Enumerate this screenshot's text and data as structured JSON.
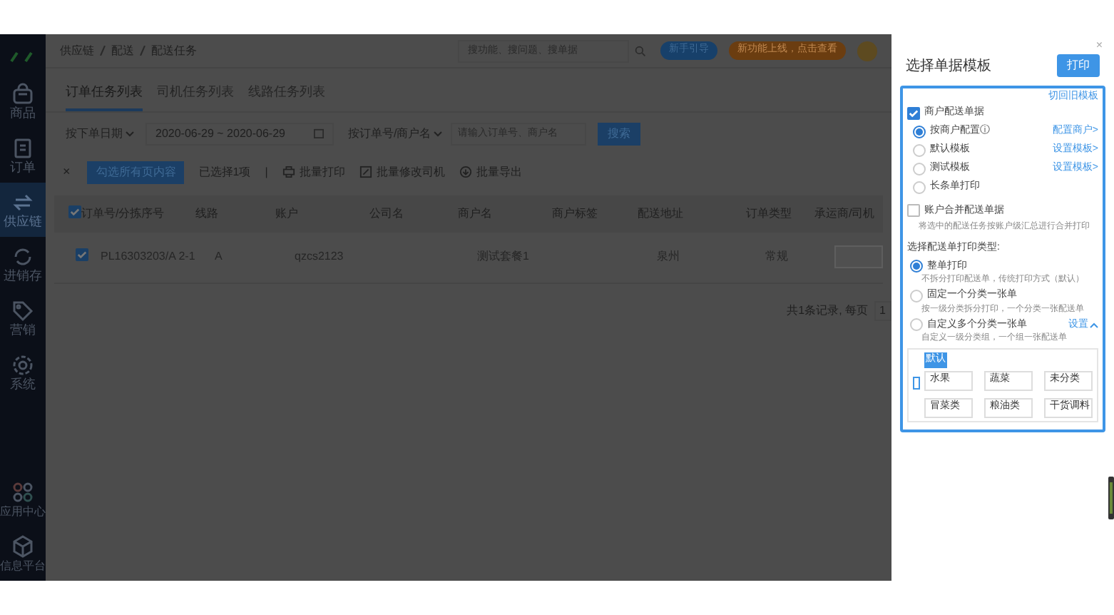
{
  "sidebar": {
    "items": [
      {
        "label": "商品",
        "selected": false
      },
      {
        "label": "订单",
        "selected": false
      },
      {
        "label": "供应链",
        "selected": true
      },
      {
        "label": "进销存",
        "selected": false
      },
      {
        "label": "营销",
        "selected": false
      },
      {
        "label": "系统",
        "selected": false
      }
    ],
    "bottom_items": [
      {
        "label": "应用中心"
      },
      {
        "label": "信息平台"
      }
    ]
  },
  "breadcrumb": [
    "供应链",
    "配送",
    "配送任务"
  ],
  "header": {
    "search_placeholder": "搜功能、搜问题、搜单据",
    "guide_button": "新手引导",
    "news_button": "新功能上线，点击查看"
  },
  "tabs": [
    {
      "label": "订单任务列表",
      "selected": true
    },
    {
      "label": "司机任务列表",
      "selected": false
    },
    {
      "label": "线路任务列表",
      "selected": false
    }
  ],
  "filters": {
    "date_type": "按下单日期",
    "date_range": "2020-06-29 ~ 2020-06-29",
    "search_type": "按订单号/商户名",
    "search_placeholder": "请输入订单号、商户名",
    "search_button": "搜索"
  },
  "toolbar": {
    "close": "×",
    "select_all_button": "勾选所有页内容",
    "selected_count": "已选择1项",
    "separator": "|",
    "actions": [
      {
        "label": "批量打印"
      },
      {
        "label": "批量修改司机"
      },
      {
        "label": "批量导出"
      }
    ]
  },
  "table": {
    "columns": [
      "订单号/分拣序号",
      "线路",
      "账户",
      "公司名",
      "商户名",
      "商户标签",
      "配送地址",
      "订单类型",
      "承运商/司机"
    ],
    "header_checked": true,
    "rows": [
      {
        "checked": true,
        "cells": [
          "PL16303203/A 2-1",
          "A",
          "qzcs2123",
          "",
          "测试套餐1",
          "",
          "泉州",
          "常规",
          ""
        ]
      }
    ]
  },
  "pagination": {
    "summary": "共1条记录, 每页",
    "page_size": "1"
  },
  "print_panel": {
    "close": "×",
    "title": "选择单据模板",
    "print_button": "打印",
    "old_template_link": "切回旧模板",
    "merchant_doc": {
      "label": "商户配送单据",
      "checked": true
    },
    "templates": [
      {
        "label": "按商户配置ⓘ",
        "selected": true,
        "link": "配置商户>"
      },
      {
        "label": "默认模板",
        "selected": false,
        "link": "设置模板>"
      },
      {
        "label": "测试模板",
        "selected": false,
        "link": "设置模板>"
      },
      {
        "label": "长条单打印",
        "selected": false
      }
    ],
    "account_merge": {
      "label": "账户合并配送单据",
      "checked": false,
      "description": "将选中的配送任务按账户级汇总进行合并打印"
    },
    "print_type_label": "选择配送单打印类型:",
    "print_types": [
      {
        "label": "整单打印",
        "description": "不拆分打印配送单，传统打印方式（默认）",
        "selected": true
      },
      {
        "label": "固定一个分类一张单",
        "description": "按一级分类拆分打印，一个分类一张配送单",
        "selected": false
      },
      {
        "label": "自定义多个分类一张单",
        "description": "自定义一级分类组，一个组一张配送单",
        "selected": false,
        "link": "设置"
      }
    ],
    "group": {
      "name": "默认",
      "categories": [
        "水果",
        "蔬菜",
        "未分类",
        "冒菜类",
        "粮油类",
        "干货调料"
      ]
    }
  }
}
